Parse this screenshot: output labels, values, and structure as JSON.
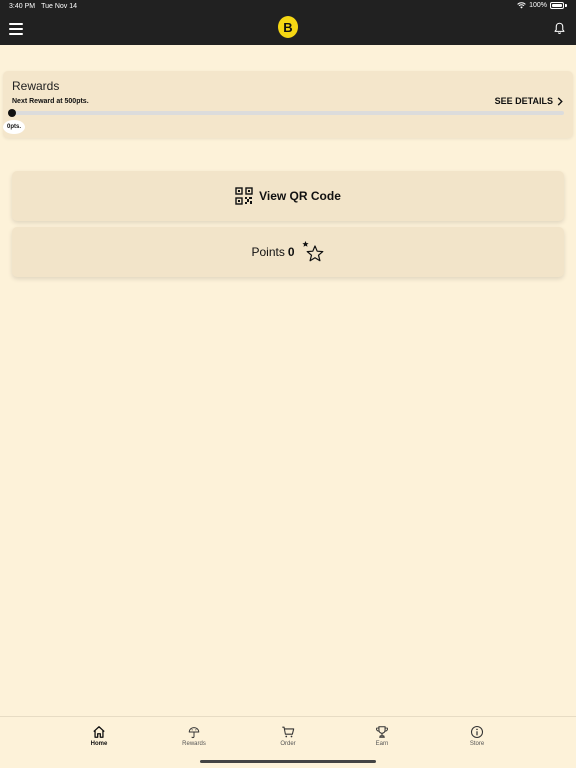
{
  "status_bar": {
    "time": "3:40 PM",
    "date": "Tue Nov 14",
    "battery": "100%"
  },
  "header": {
    "logo_letter": "B"
  },
  "rewards": {
    "title": "Rewards",
    "next_reward": "Next Reward at 500pts.",
    "see_details": "SEE DETAILS",
    "points_label": "0pts.",
    "progress": 0
  },
  "qr": {
    "label": "View QR Code"
  },
  "points": {
    "label": "Points",
    "value": "0"
  },
  "tabs": [
    {
      "label": "Home",
      "icon": "home-icon",
      "active": true
    },
    {
      "label": "Rewards",
      "icon": "rewards-icon",
      "active": false
    },
    {
      "label": "Order",
      "icon": "cart-icon",
      "active": false
    },
    {
      "label": "Earn",
      "icon": "trophy-icon",
      "active": false
    },
    {
      "label": "Store",
      "icon": "info-icon",
      "active": false
    }
  ],
  "colors": {
    "background": "#fdf2d9",
    "header": "#212121",
    "brand_yellow": "#f5d713",
    "card": "#f4e6cb"
  }
}
